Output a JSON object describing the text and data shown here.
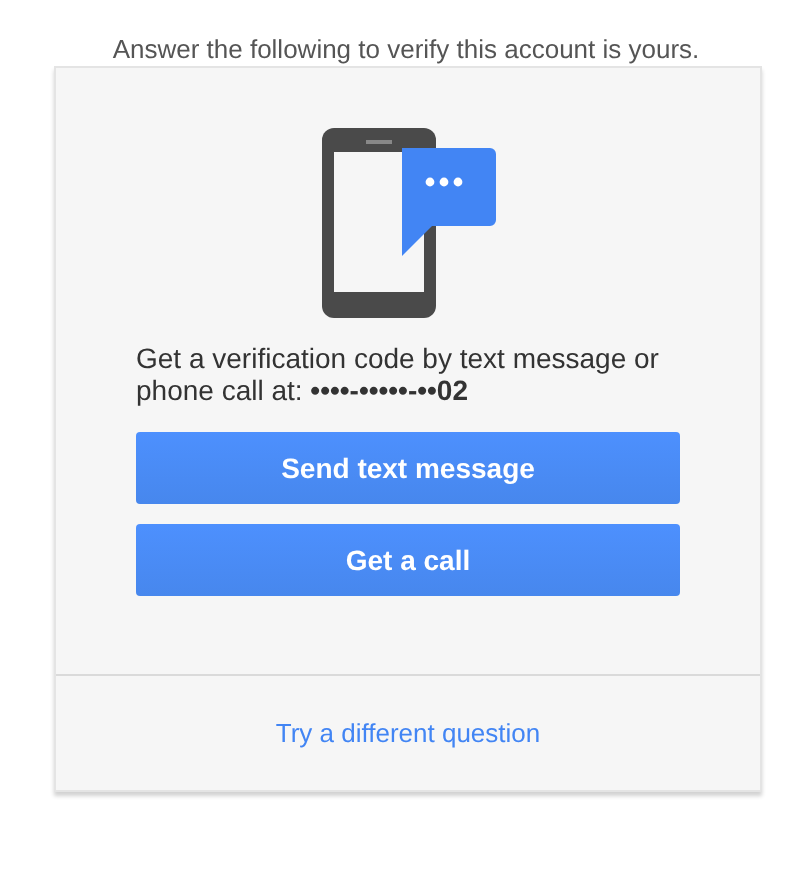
{
  "instruction": "Answer the following to verify this account is yours.",
  "card": {
    "message": "Get a verification code by text message or phone call at: **••••-•••••-••02**",
    "buttons": [
      "Send text message",
      "Get a call"
    ],
    "footer_link": "Try a different question"
  }
}
